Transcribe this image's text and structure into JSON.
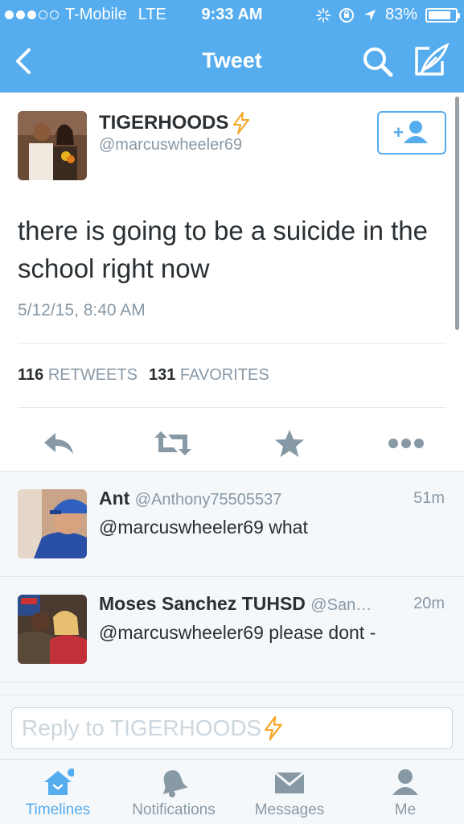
{
  "status_bar": {
    "carrier": "T-Mobile",
    "network": "LTE",
    "time": "9:33 AM",
    "battery": "83%",
    "battery_level": 0.83
  },
  "nav": {
    "title": "Tweet",
    "back_icon": "chevron-left-icon",
    "search_icon": "search-icon",
    "compose_icon": "compose-icon"
  },
  "tweet": {
    "name": "TIGERHOODS",
    "handle": "@marcuswheeler69",
    "text": "there is going to be a suicide in the school right now",
    "date": "5/12/15, 8:40 AM",
    "retweets_count": "116",
    "retweets_label": "RETWEETS",
    "favorites_count": "131",
    "favorites_label": "FAVORITES"
  },
  "replies": [
    {
      "name": "Ant",
      "handle": "@Anthony75505537",
      "time": "51m",
      "text": "@marcuswheeler69 what"
    },
    {
      "name": "Moses Sanchez TUHSD",
      "handle": "@San…",
      "time": "20m",
      "text": "@marcuswheeler69 please dont -"
    }
  ],
  "reply_bar": {
    "placeholder": "Reply to TIGERHOODS"
  },
  "tabs": [
    {
      "label": "Timelines",
      "icon": "home-icon",
      "active": true
    },
    {
      "label": "Notifications",
      "icon": "bell-icon",
      "active": false
    },
    {
      "label": "Messages",
      "icon": "envelope-icon",
      "active": false
    },
    {
      "label": "Me",
      "icon": "person-icon",
      "active": false
    }
  ],
  "colors": {
    "brand": "#55acee",
    "text": "#292f33",
    "muted": "#8899a6",
    "lightning": "#f5a623"
  }
}
